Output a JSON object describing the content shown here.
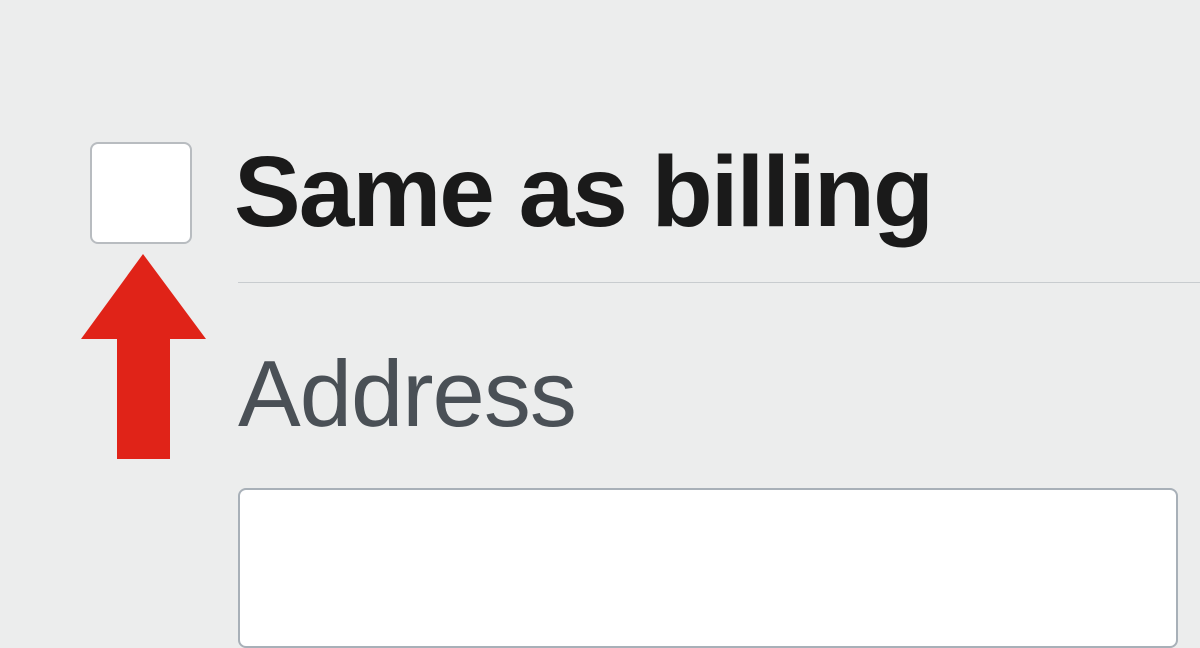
{
  "form": {
    "same_as_billing_label": "Same as billing",
    "address_label": "Address",
    "address_value": ""
  },
  "annotation": {
    "arrow_color": "#e02318"
  }
}
